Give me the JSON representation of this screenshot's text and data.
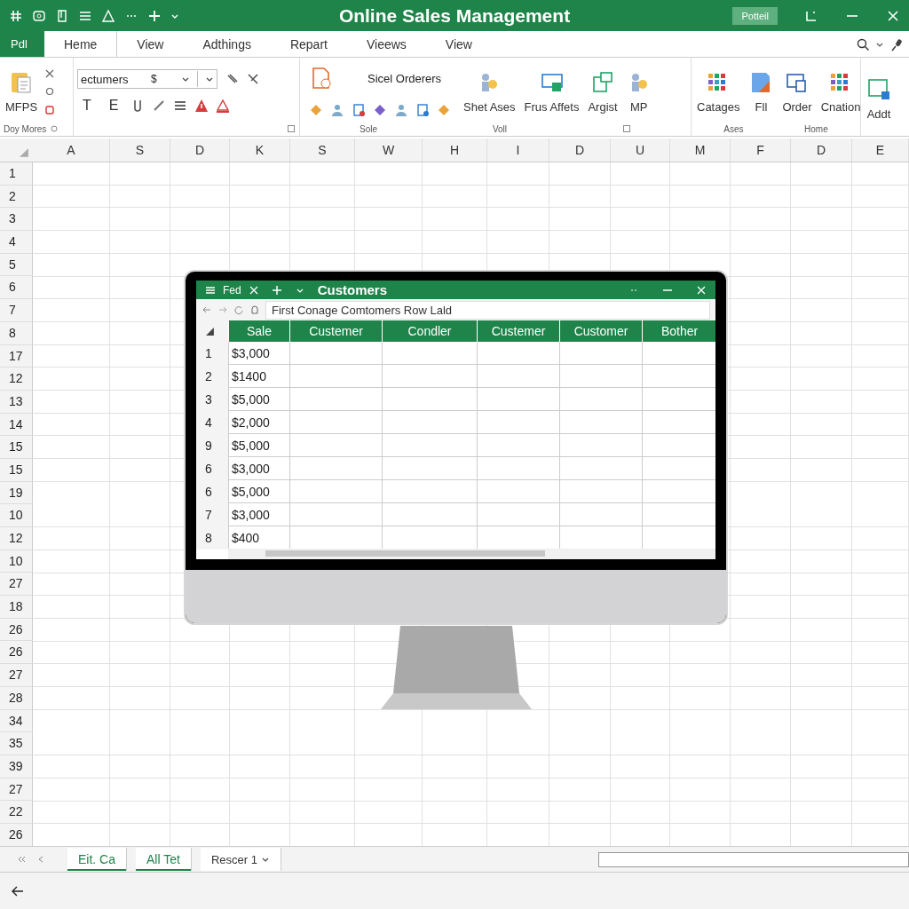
{
  "title_bar": {
    "title": "Online Sales Management",
    "button": "Potteil"
  },
  "tabs": [
    {
      "label": "Pdl",
      "kind": "file",
      "selected": false
    },
    {
      "label": "Heme",
      "kind": "tab",
      "selected": true
    },
    {
      "label": "View",
      "kind": "tab",
      "selected": false
    },
    {
      "label": "Adthings",
      "kind": "tab",
      "selected": false
    },
    {
      "label": "Repart",
      "kind": "tab",
      "selected": false
    },
    {
      "label": "Vieews",
      "kind": "tab",
      "selected": false
    },
    {
      "label": "View",
      "kind": "tab",
      "selected": false
    }
  ],
  "ribbon": {
    "clipboard": {
      "button": "MFPS",
      "label": "Doy Mores"
    },
    "font": {
      "field": "ectumers",
      "symbol": "$",
      "buttons": [
        "T",
        "E"
      ]
    },
    "orders": {
      "title": "Sicel Orderers",
      "buttons": [
        "Shet Ases",
        "Frus Affets",
        "Argist",
        "MP"
      ],
      "labels": [
        "Sole",
        "Voll"
      ]
    },
    "categories": {
      "buttons": [
        "Catages",
        "Fll",
        "Order",
        "Cnation"
      ],
      "labels": [
        "Ases",
        "Home"
      ]
    },
    "add": {
      "button": "Addt"
    }
  },
  "columns": [
    "A",
    "S",
    "D",
    "K",
    "S",
    "W",
    "H",
    "I",
    "D",
    "U",
    "M",
    "F",
    "D",
    "E"
  ],
  "rows": [
    "1",
    "2",
    "3",
    "4",
    "5",
    "6",
    "7",
    "8",
    "17",
    "12",
    "13",
    "14",
    "15",
    "15",
    "19",
    "10",
    "12",
    "10",
    "27",
    "18",
    "26",
    "26",
    "27",
    "28",
    "34",
    "35",
    "39",
    "27",
    "22",
    "26"
  ],
  "embedded_window": {
    "tab": "Fed",
    "title": "Customers",
    "address": "First Conage Comtomers Row Lald",
    "columns": [
      "Sale",
      "Custemer",
      "Condler",
      "Custemer",
      "Customer",
      "Bother"
    ],
    "rows": [
      {
        "number": "1",
        "sale": "$3,000"
      },
      {
        "number": "2",
        "sale": "$1400"
      },
      {
        "number": "3",
        "sale": "$5,000"
      },
      {
        "number": "4",
        "sale": "$2,000"
      },
      {
        "number": "9",
        "sale": "$5,000"
      },
      {
        "number": "6",
        "sale": "$3,000"
      },
      {
        "number": "6",
        "sale": "$5,000"
      },
      {
        "number": "7",
        "sale": "$3,000"
      },
      {
        "number": "8",
        "sale": "$400"
      }
    ]
  },
  "sheet_tabs": [
    {
      "label": "Eit. Ca",
      "selected": true,
      "dropdown": false
    },
    {
      "label": "All Tet",
      "selected": true,
      "dropdown": false
    },
    {
      "label": "Rescer 1",
      "selected": false,
      "dropdown": true
    }
  ]
}
